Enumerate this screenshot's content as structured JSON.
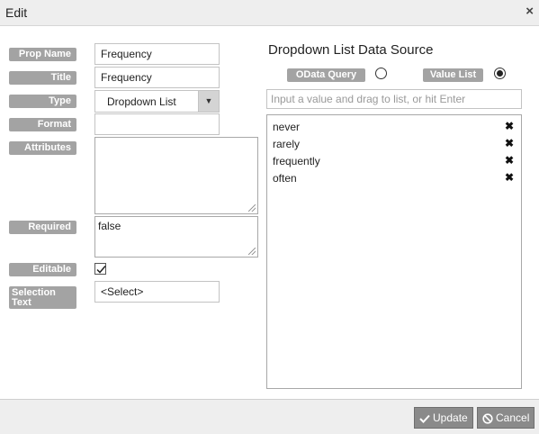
{
  "dialog": {
    "title": "Edit",
    "close_icon": "×"
  },
  "fields": {
    "prop_name": {
      "label": "Prop Name",
      "value": "Frequency"
    },
    "title": {
      "label": "Title",
      "value": "Frequency"
    },
    "type": {
      "label": "Type",
      "value": "Dropdown List",
      "arrow": "▼"
    },
    "format": {
      "label": "Format",
      "value": ""
    },
    "attributes": {
      "label": "Attributes",
      "value": ""
    },
    "required": {
      "label": "Required",
      "value": "false"
    },
    "editable": {
      "label": "Editable",
      "checked": true
    },
    "selection_text": {
      "label": "Selection Text",
      "value": "<Select>"
    }
  },
  "data_source": {
    "title": "Dropdown List Data Source",
    "odata_label": "OData Query",
    "odata_selected": false,
    "value_list_label": "Value List",
    "value_list_selected": true,
    "input_placeholder": "Input a value and drag to list, or hit Enter",
    "remove_icon": "✖",
    "items": [
      "never",
      "rarely",
      "frequently",
      "often"
    ]
  },
  "footer": {
    "update_label": "Update",
    "cancel_label": "Cancel"
  }
}
